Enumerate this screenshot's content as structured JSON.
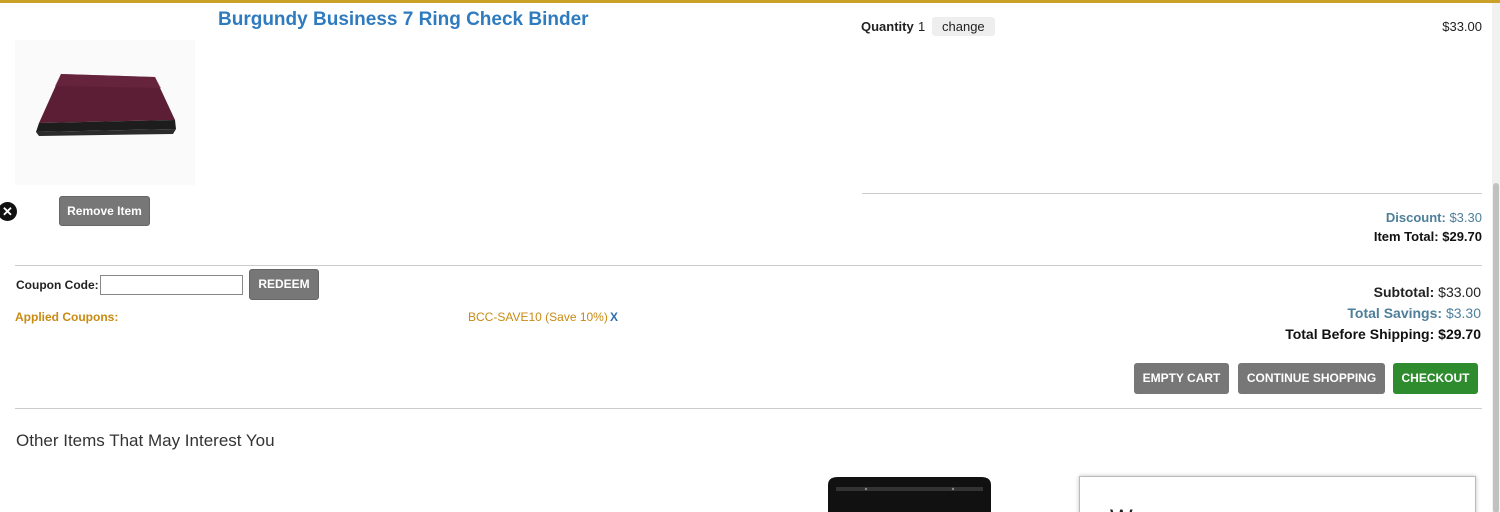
{
  "cart_item": {
    "name": "Burgundy Business 7 Ring Check Binder",
    "image_icon": "binder-image",
    "quantity_label": "Quantity",
    "quantity_value": "1",
    "change_label": "change",
    "price": "$33.00",
    "remove_label": "Remove Item",
    "discount_label": "Discount:",
    "discount_value": "$3.30",
    "item_total_label": "Item Total:",
    "item_total_value": "$29.70"
  },
  "coupon": {
    "label": "Coupon Code:",
    "input_value": "",
    "redeem_label": "REDEEM",
    "applied_label": "Applied Coupons:",
    "applied_code": "BCC-SAVE10 (Save 10%)",
    "applied_remove": "X"
  },
  "summary": {
    "subtotal_label": "Subtotal:",
    "subtotal_value": "$33.00",
    "savings_label": "Total Savings:",
    "savings_value": "$3.30",
    "before_shipping_label": "Total Before Shipping:",
    "before_shipping_value": "$29.70"
  },
  "actions": {
    "empty_cart": "EMPTY CART",
    "continue_shopping": "CONTINUE SHOPPING",
    "checkout": "CHECKOUT"
  },
  "recommendations": {
    "title": "Other Items That May Interest You"
  },
  "popup": {
    "title_fragment": "W"
  },
  "colors": {
    "link_blue": "#2f7bbf",
    "coupon_orange": "#c98a12",
    "savings_blue": "#4e7f9a",
    "checkout_green": "#2e8b2e",
    "button_gray": "#777777"
  }
}
